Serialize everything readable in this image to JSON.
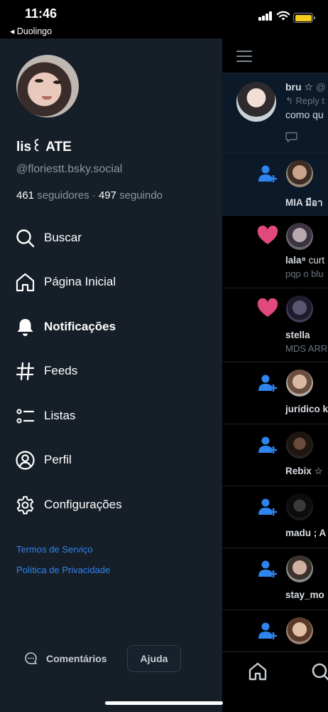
{
  "status_bar": {
    "time": "11:46",
    "back_label": "◂ Duolingo",
    "battery_color": "#f4cd1c"
  },
  "drawer": {
    "profile": {
      "display_name": "lis꒰ ATE",
      "handle": "@floriestt.bsky.social",
      "followers_count": "461",
      "followers_label": "seguidores",
      "separator": "·",
      "following_count": "497",
      "following_label": "seguindo"
    },
    "menu": [
      {
        "label": "Buscar",
        "icon": "search-icon"
      },
      {
        "label": "Página Inicial",
        "icon": "home-icon"
      },
      {
        "label": "Notificações",
        "icon": "bell-icon",
        "active": true
      },
      {
        "label": "Feeds",
        "icon": "hash-icon"
      },
      {
        "label": "Listas",
        "icon": "list-icon"
      },
      {
        "label": "Perfil",
        "icon": "person-circle-icon"
      },
      {
        "label": "Configurações",
        "icon": "gear-icon"
      }
    ],
    "links": {
      "terms": "Termos de Serviço",
      "privacy": "Política de Privacidade"
    },
    "footer": {
      "feedback_label": "Comentários",
      "help_label": "Ajuda"
    },
    "accent_color": "#2f84ee",
    "background_color": "#161e27"
  },
  "background_app": {
    "post": {
      "author": "bru ☆",
      "author_suffix": "@",
      "reply_text": "↰ Reply t",
      "text": "como qu"
    },
    "notifications": [
      {
        "kind": "follow",
        "name": "MIA มีอา",
        "rest": "",
        "sub": ""
      },
      {
        "kind": "like",
        "name": "lala⁸",
        "rest": " curt",
        "sub": "pqp o blu"
      },
      {
        "kind": "like",
        "name": "stella",
        "rest": "",
        "sub": "MDS ARR"
      },
      {
        "kind": "follow",
        "name": "jurídico k",
        "rest": "",
        "sub": ""
      },
      {
        "kind": "follow",
        "name": "Rebix ☆",
        "rest": "",
        "sub": ""
      },
      {
        "kind": "follow",
        "name": "madu ; A",
        "rest": "",
        "sub": ""
      },
      {
        "kind": "follow",
        "name": "stay_mo",
        "rest": "",
        "sub": ""
      },
      {
        "kind": "follow",
        "name": "",
        "rest": "",
        "sub": ""
      }
    ],
    "like_color": "#e0487e",
    "follow_color": "#2f84ee"
  }
}
